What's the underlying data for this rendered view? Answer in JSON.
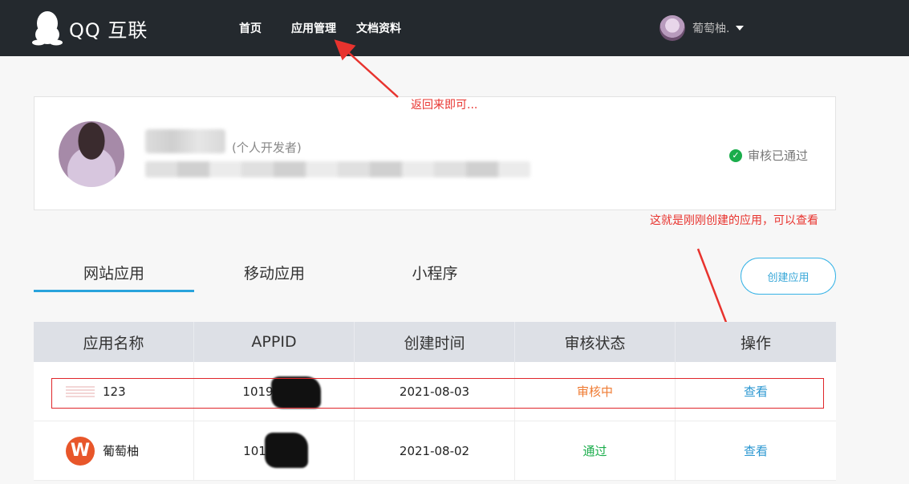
{
  "header": {
    "logo_text": "QQ 互联",
    "nav": [
      "首页",
      "应用管理",
      "文档资料"
    ],
    "user_name": "葡萄柚."
  },
  "profile": {
    "dev_type": "(个人开发者)",
    "audit_status": "审核已通过"
  },
  "annotations": {
    "back_note": "返回来即可...",
    "app_note": "这就是刚刚创建的应用，可以查看"
  },
  "tabs": [
    "网站应用",
    "移动应用",
    "小程序"
  ],
  "create_button": "创建应用",
  "table": {
    "headers": [
      "应用名称",
      "APPID",
      "创建时间",
      "审核状态",
      "操作"
    ],
    "rows": [
      {
        "name": "123",
        "appid": "1019",
        "created": "2021-08-03",
        "status": "审核中",
        "action": "查看"
      },
      {
        "name": "葡萄柚",
        "appid": "101",
        "created": "2021-08-02",
        "status": "通过",
        "action": "查看"
      }
    ]
  },
  "colors": {
    "topbar": "#24292e",
    "accent": "#29a3dc",
    "pending": "#ef7b33",
    "pass": "#1aad4b",
    "annotation": "#e8332e"
  }
}
